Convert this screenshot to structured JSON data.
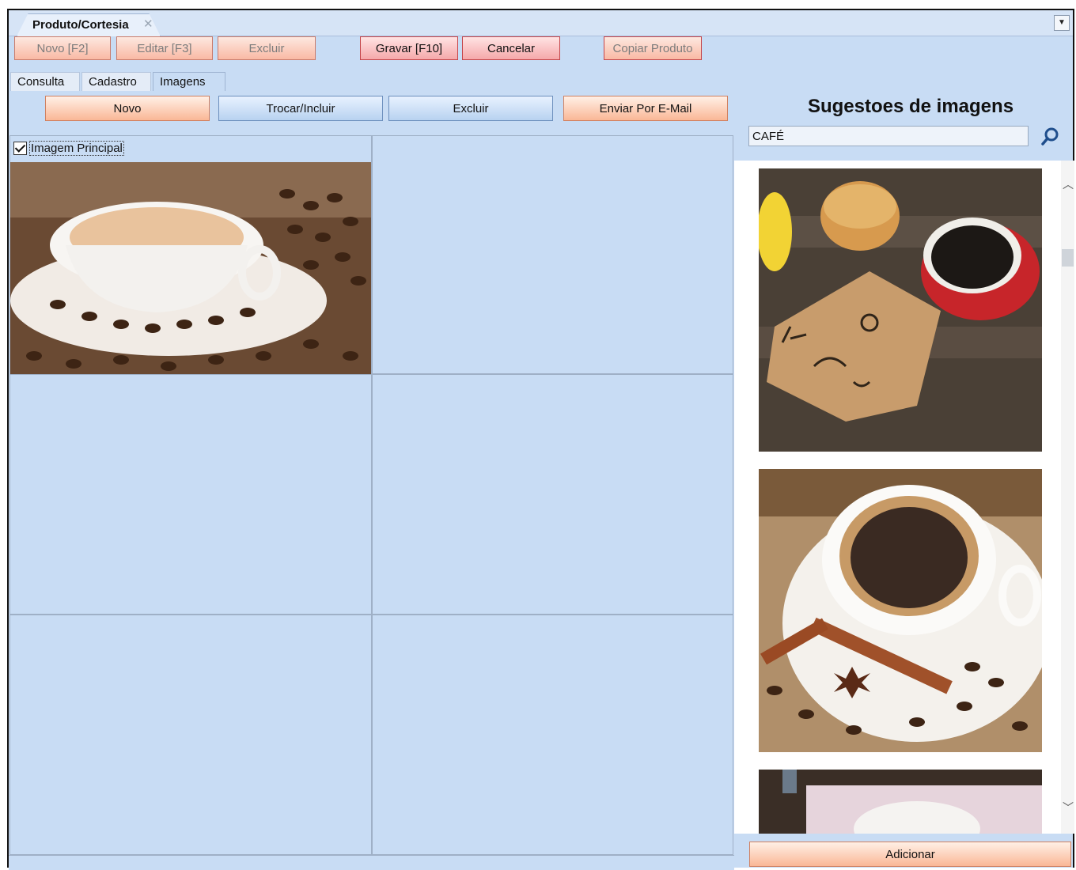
{
  "window": {
    "tab_title": "Produto/Cortesia",
    "close_glyph": "✕",
    "dropdown_glyph": "▼"
  },
  "toolbar": {
    "novo": "Novo [F2]",
    "editar": "Editar [F3]",
    "excluir": "Excluir",
    "gravar": "Gravar [F10]",
    "cancelar": "Cancelar",
    "copiar": "Copiar Produto"
  },
  "tabs": {
    "consulta": "Consulta",
    "cadastro": "Cadastro",
    "imagens": "Imagens"
  },
  "image_actions": {
    "novo": "Novo",
    "trocar": "Trocar/Incluir",
    "excluir": "Excluir",
    "enviar": "Enviar Por E-Mail"
  },
  "main_image": {
    "checkbox_label": "Imagem Principal",
    "checked": true
  },
  "suggestions": {
    "title": "Sugestoes de imagens",
    "search_value": "CAFÉ",
    "add_button": "Adicionar"
  },
  "icons": {
    "search": "search-icon",
    "scroll_up": "chevron-up-icon",
    "scroll_down": "chevron-down-icon"
  },
  "colors": {
    "panel_bg": "#c8dcf4",
    "button_orange": "#fab796",
    "button_red": "#f5a8aa",
    "button_blue": "#b8d2f0"
  }
}
